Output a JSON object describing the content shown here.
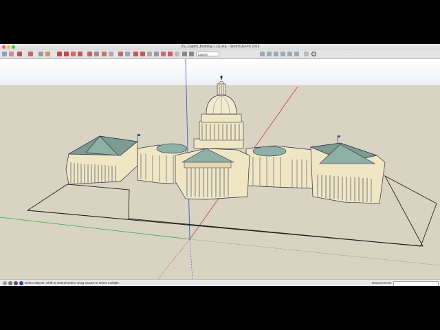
{
  "window": {
    "title": "US_Capitol_Building-1 (1).skp - SketchUp Pro 2016"
  },
  "toolbar": {
    "layer_value": "Layer0",
    "tools": [
      "select-tool",
      "eraser-tool",
      "paint-bucket-tool",
      "line-tool",
      "rectangle-tool",
      "circle-tool",
      "arc-tool",
      "push-pull-tool",
      "move-tool",
      "rotate-tool",
      "scale-tool",
      "offset-tool",
      "follow-me-tool",
      "tape-measure-tool",
      "dimension-tool",
      "protractor-tool",
      "text-tool",
      "axes-tool",
      "3d-text-tool",
      "orbit-tool",
      "pan-tool",
      "zoom-tool",
      "zoom-extents-tool",
      "previous-view-tool",
      "walk-tool",
      "look-around-tool",
      "position-camera-tool",
      "section-plane-tool",
      "styles-tool",
      "iso-view",
      "top-view",
      "front-view",
      "right-view",
      "back-view",
      "left-view",
      "xray-style",
      "back-edges-style",
      "wireframe-style",
      "hidden-line-style",
      "shaded-style",
      "textured-style",
      "monochrome-style",
      "shadows-toggle",
      "fog-toggle",
      "warehouse-tool",
      "extension-tool"
    ]
  },
  "status": {
    "hint": "Select objects. Shift to extend select. Drag mouse to select multiple.",
    "measurements_label": "Measurements",
    "measurements_value": ""
  },
  "colors": {
    "sky": "#ffffff",
    "ground": "#d9d3c2",
    "stone": "#efe6c4",
    "roof": "#7d9b90",
    "red_axis": "#b04040",
    "green_axis": "#3aa84a",
    "blue_axis": "#2a4fd0"
  }
}
